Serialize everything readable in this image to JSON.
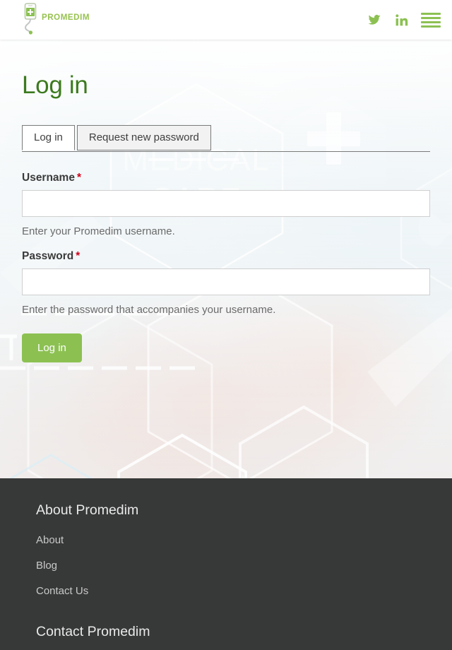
{
  "header": {
    "logo_text": "PROMEDIM",
    "logo_icon": "medical-device-plug-icon",
    "social": [
      {
        "name": "twitter-icon",
        "glyph": "twitter"
      },
      {
        "name": "linkedin-icon",
        "glyph": "in"
      }
    ],
    "menu_icon": "hamburger-menu-icon",
    "accent_color": "#8cc152"
  },
  "hero": {
    "background_alt": "medical-care-hexagon-background",
    "background_words": [
      "MEDICAL",
      "CARE"
    ]
  },
  "page": {
    "title": "Log in"
  },
  "tabs": [
    {
      "label": "Log in",
      "active": true
    },
    {
      "label": "Request new password",
      "active": false
    }
  ],
  "form": {
    "username": {
      "label": "Username",
      "required_marker": "*",
      "value": "",
      "placeholder": "",
      "help": "Enter your Promedim username."
    },
    "password": {
      "label": "Password",
      "required_marker": "*",
      "value": "",
      "placeholder": "",
      "help": "Enter the password that accompanies your username."
    },
    "submit_label": "Log in"
  },
  "footer": {
    "about_heading": "About Promedim",
    "links": [
      {
        "label": "About"
      },
      {
        "label": "Blog"
      },
      {
        "label": "Contact Us"
      }
    ],
    "contact_heading": "Contact Promedim",
    "background_color": "#373838"
  }
}
